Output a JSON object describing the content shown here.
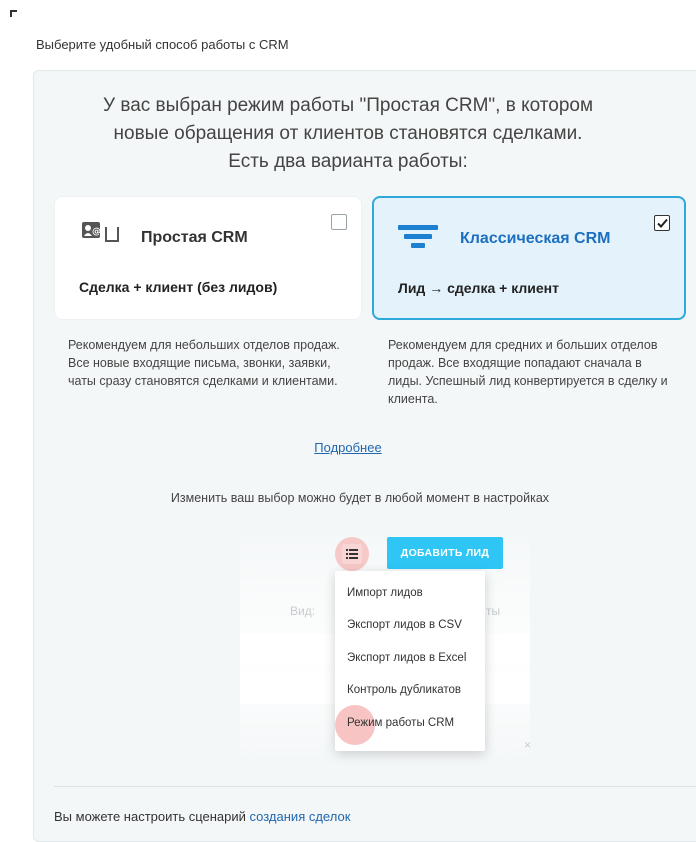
{
  "page_title": "Выберите удобный способ работы с CRM",
  "headline": "У вас выбран режим работы \"Простая CRM\", в котором\nновые обращения от клиентов становятся сделками.\nЕсть два варианта работы:",
  "modes": {
    "simple": {
      "title": "Простая CRM",
      "formula": "Сделка + клиент (без лидов)",
      "checked": false,
      "description": "Рекомендуем для небольших отделов продаж. Все новые входящие письма, звонки, заявки, чаты сразу становятся сделками и клиентами."
    },
    "classic": {
      "title": "Классическая CRM",
      "formula": "Лид → сделка + клиент",
      "checked": true,
      "description": "Рекомендуем для средних и больших отделов продаж. Все входящие попадают сначала в лиды. Успешный лид конвертируется в сделку и клиента."
    }
  },
  "more_link": "Подробнее",
  "change_note": "Изменить ваш выбор можно будет в любой момент в настройках",
  "preview": {
    "add_lead_button": "ДОБАВИТЬ ЛИД",
    "view_label": "Вид:",
    "faded_suffix": "ты",
    "menu_items": [
      "Импорт лидов",
      "Экспорт лидов в CSV",
      "Экспорт лидов в Excel",
      "Контроль дубликатов",
      "Режим работы CRM"
    ]
  },
  "footer": {
    "text": "Вы можете настроить сценарий ",
    "link": "создания сделок"
  },
  "colors": {
    "accent": "#2fa8dc",
    "button": "#2fc6f6",
    "link": "#2067b0",
    "highlight": "#f5b4b4"
  }
}
